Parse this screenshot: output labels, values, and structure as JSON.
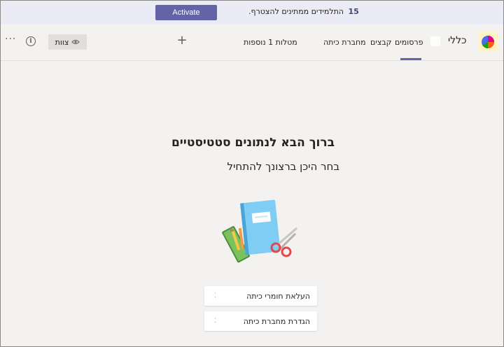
{
  "banner": {
    "count": "15",
    "message": "התלמידים ממתינים להצטרף.",
    "activate_label": "Activate"
  },
  "header": {
    "channel_name": "כללי",
    "tabs": [
      {
        "label": "פרסומים",
        "active": true
      },
      {
        "label": "קבצים",
        "active": false
      },
      {
        "label": "מחברת כיתה",
        "active": false
      },
      {
        "label": "מטלות 1 נוספות",
        "active": false
      }
    ],
    "add_tab_symbol": "+",
    "team_label": "צוות",
    "more_symbol": "···"
  },
  "main": {
    "title": "ברוך הבא לנתונים סטטיסטיים",
    "subtitle": "בחר היכן ברצונך להתחיל",
    "actions": [
      {
        "label": "העלאת חומרי כיתה"
      },
      {
        "label": "הגדרת מחברת כיתה"
      }
    ]
  },
  "colors": {
    "accent": "#6264a7",
    "background": "#f3f2f1",
    "banner": "#ebebf5"
  },
  "icons": {
    "team_avatar": "pie-chart-icon",
    "team_button": "eye-icon",
    "info": "info-icon",
    "more": "more-options-icon",
    "add_tab": "plus-icon"
  }
}
